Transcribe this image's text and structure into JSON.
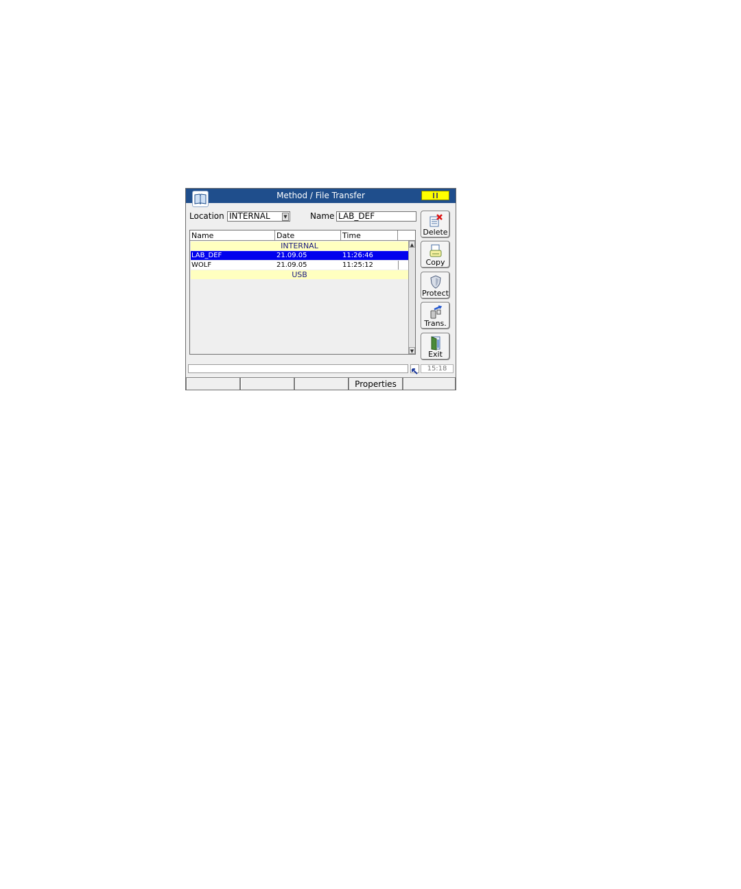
{
  "window": {
    "title": "Method / File Transfer"
  },
  "form": {
    "location_label": "Location",
    "location_value": "INTERNAL",
    "name_label": "Name",
    "name_value": "LAB_DEF"
  },
  "table": {
    "headers": [
      "Name",
      "Date",
      "Time"
    ],
    "groups": [
      {
        "label": "INTERNAL",
        "rows": [
          {
            "name": "LAB_DEF",
            "date": "21.09.05",
            "time": "11:26:46",
            "selected": true
          },
          {
            "name": "WOLF",
            "date": "21.09.05",
            "time": "11:25:12",
            "selected": false
          }
        ]
      },
      {
        "label": "USB",
        "rows": []
      }
    ]
  },
  "side_buttons": [
    {
      "label": "Delete",
      "icon": "delete-icon"
    },
    {
      "label": "Copy",
      "icon": "copy-icon"
    },
    {
      "label": "Protect",
      "icon": "shield-icon"
    },
    {
      "label": "Trans.",
      "icon": "transfer-icon"
    },
    {
      "label": "Exit",
      "icon": "exit-door-icon"
    }
  ],
  "status": {
    "clock": "15:18"
  },
  "softkeys": [
    "",
    "",
    "",
    "Properties",
    ""
  ],
  "colors": {
    "titlebar": "#1f4e8c",
    "selection": "#0000ee",
    "group_row": "#ffffc0",
    "status_pill": "#ffff00"
  }
}
